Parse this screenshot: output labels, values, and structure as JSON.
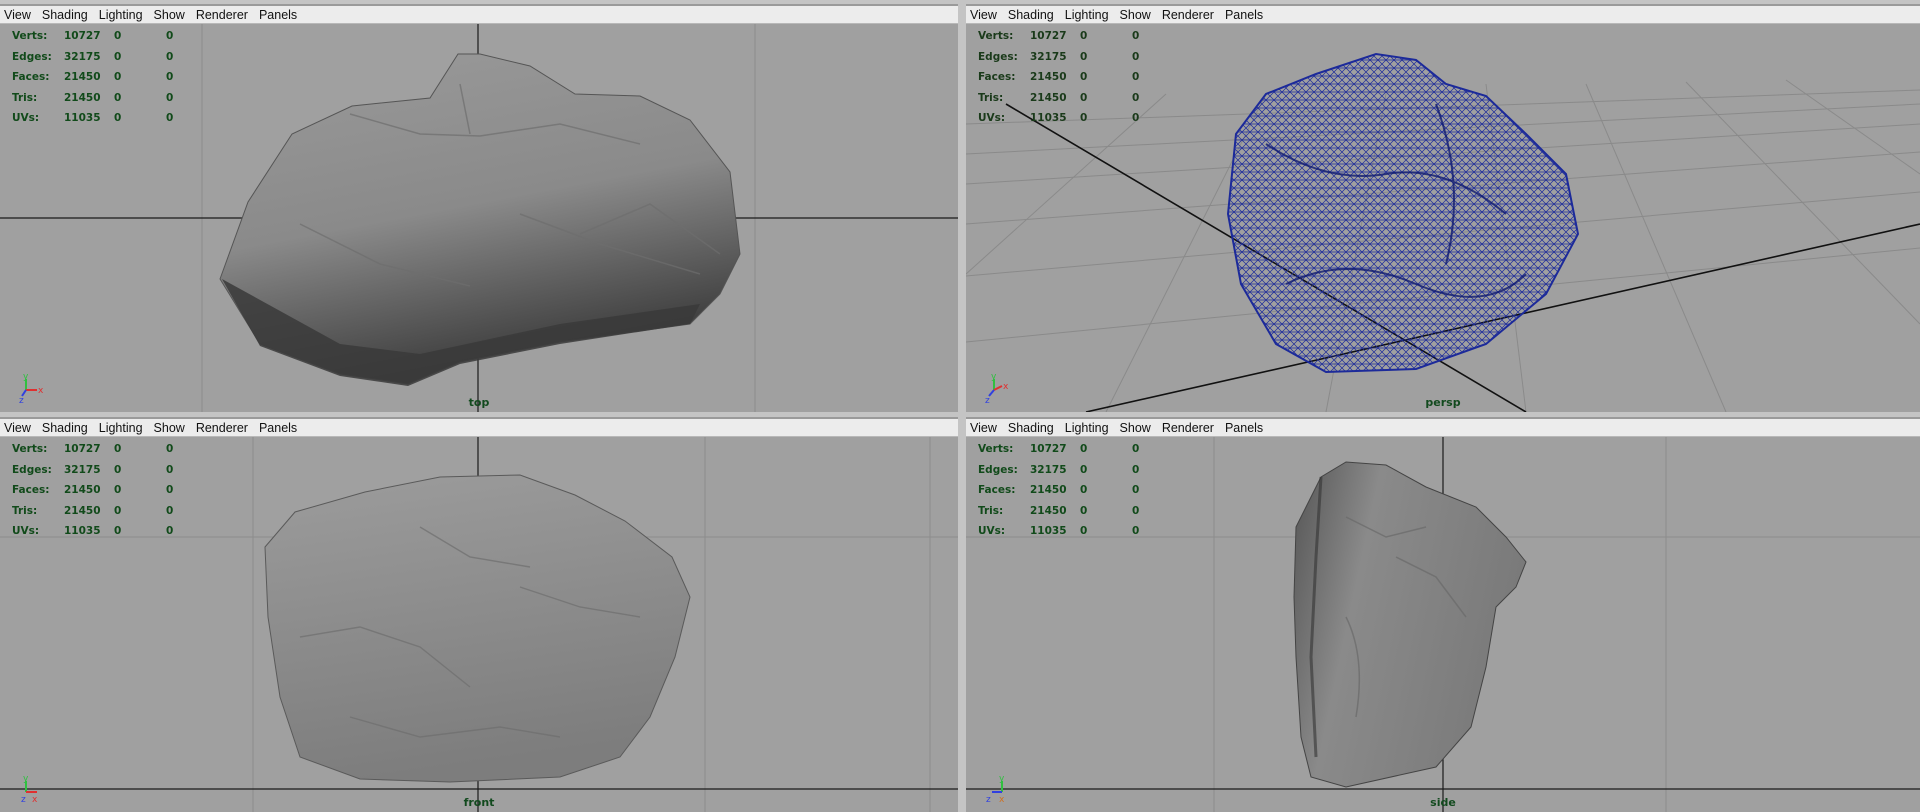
{
  "menu": [
    "View",
    "Shading",
    "Lighting",
    "Show",
    "Renderer",
    "Panels"
  ],
  "hud_stats": [
    {
      "label": "Verts:",
      "values": [
        "10727",
        "0",
        "0"
      ]
    },
    {
      "label": "Edges:",
      "values": [
        "32175",
        "0",
        "0"
      ]
    },
    {
      "label": "Faces:",
      "values": [
        "21450",
        "0",
        "0"
      ]
    },
    {
      "label": "Tris:",
      "values": [
        "21450",
        "0",
        "0"
      ]
    },
    {
      "label": "UVs:",
      "values": [
        "11035",
        "0",
        "0"
      ]
    }
  ],
  "panels": {
    "top": {
      "camera_label": "top",
      "axes": [
        "y",
        "x",
        "z"
      ]
    },
    "persp": {
      "camera_label": "persp",
      "axes": [
        "y",
        "z",
        "x"
      ]
    },
    "front": {
      "camera_label": "front",
      "axes": [
        "y",
        "z",
        "x"
      ]
    },
    "side": {
      "camera_label": "side",
      "axes": [
        "y",
        "z",
        "x"
      ]
    }
  },
  "colors": {
    "viewport_bg": "#a0a0a0",
    "hud_text": "#114a1a",
    "wireframe": "#1c2a9a",
    "axis_x": "#e03030",
    "axis_y": "#30c040",
    "axis_z": "#3040e0"
  }
}
